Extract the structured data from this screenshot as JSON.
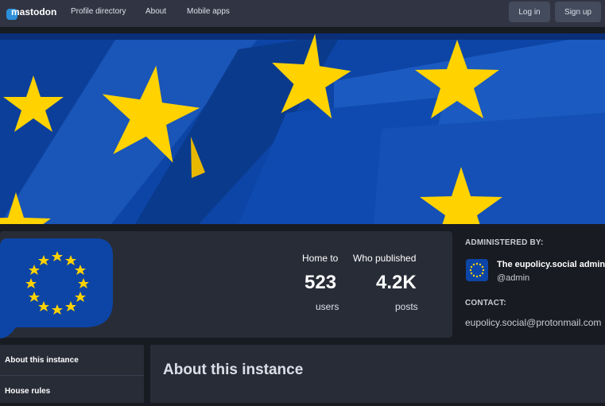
{
  "topbar": {
    "logo_text": "mastodon",
    "nav": [
      "Profile directory",
      "About",
      "Mobile apps"
    ],
    "login_label": "Log in",
    "signup_label": "Sign up"
  },
  "stats": {
    "users": {
      "prefix": "Home to",
      "value": "523",
      "unit": "users"
    },
    "posts": {
      "prefix": "Who published",
      "value": "4.2K",
      "unit": "posts"
    }
  },
  "admin": {
    "heading": "ADMINISTERED BY:",
    "name": "The eupolicy.social admin",
    "handle": "@admin"
  },
  "contact": {
    "heading": "CONTACT:",
    "email": "eupolicy.social@protonmail.com"
  },
  "sidebar": {
    "items": [
      "About this instance",
      "House rules"
    ]
  },
  "main": {
    "title": "About this instance"
  },
  "colors": {
    "background": "#191b22",
    "topbar": "#313543",
    "card": "#282c37",
    "eu_blue": "#0d45a6",
    "eu_star": "#ffd200",
    "brand": "#2b90d9"
  }
}
